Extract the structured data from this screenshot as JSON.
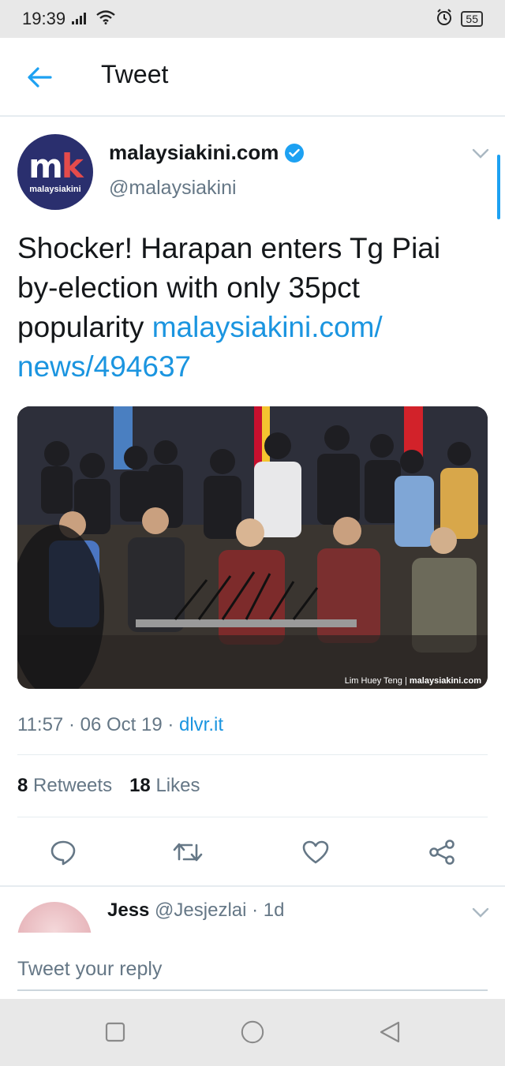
{
  "status_bar": {
    "time": "19:39",
    "battery": "55",
    "icons": [
      "signal-icon",
      "wifi-icon",
      "alarm-icon",
      "battery-icon"
    ]
  },
  "header": {
    "title": "Tweet",
    "back_icon": "back-arrow-icon"
  },
  "tweet": {
    "avatar": {
      "logo_text_m": "m",
      "logo_text_k": "k",
      "logo_caption": "malaysiakini"
    },
    "author_name": "malaysiakini.com",
    "author_handle": "@malaysiakini",
    "verified": true,
    "text_plain": "Shocker! Harapan enters Tg Piai by-election with only 35pct popularity ",
    "text_link": "malaysiakini.com/ news/494637",
    "photo_credit_name": "Lim Huey Teng",
    "photo_credit_brand": "malaysiakini.com",
    "timestamp": "11:57 · 06 Oct 19 · ",
    "source": "dlvr.it",
    "retweets_count": "8",
    "retweets_label": "Retweets",
    "likes_count": "18",
    "likes_label": "Likes",
    "actions": [
      "reply-icon",
      "retweet-icon",
      "like-icon",
      "share-icon"
    ]
  },
  "reply": {
    "author_name": "Jess",
    "author_meta": " @Jesjezlai · 1d"
  },
  "compose": {
    "placeholder": "Tweet your reply"
  },
  "colors": {
    "accent": "#1da1f2",
    "link": "#1b95e0",
    "text": "#14171a",
    "secondary": "#657786",
    "avatar_bg": "#2a2f6e",
    "logo_k": "#e44b4b"
  }
}
